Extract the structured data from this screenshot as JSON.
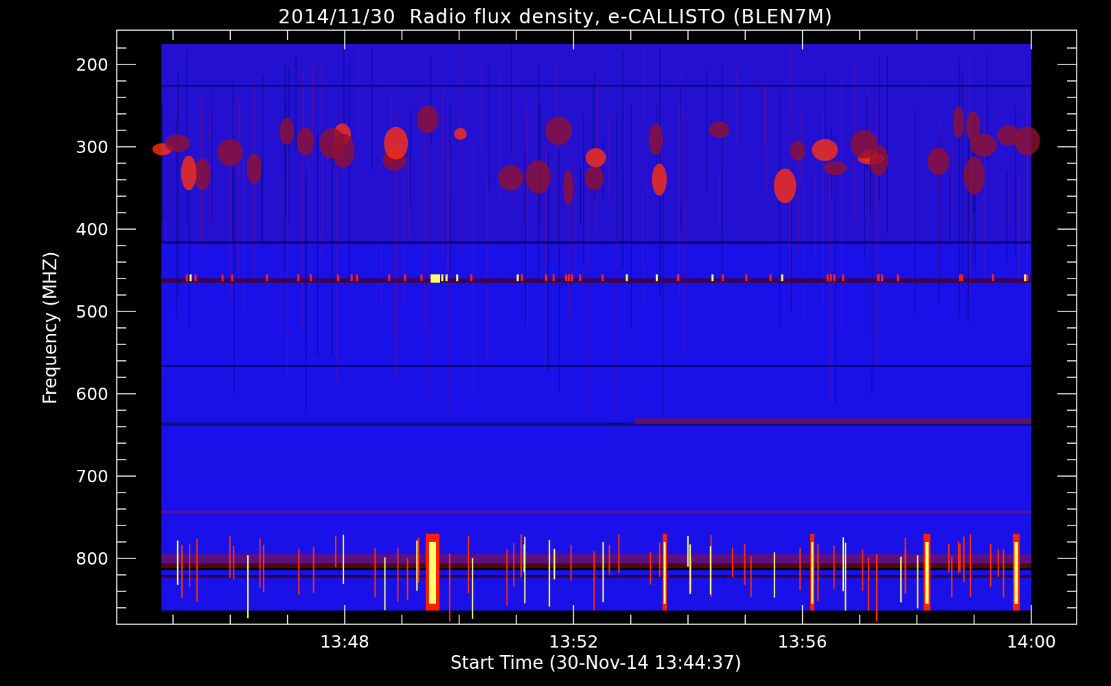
{
  "title": "2014/11/30  Radio flux density, e-CALLISTO (BLEN7M)",
  "y_axis": {
    "label": "Frequency (MHZ)",
    "ticks": [
      "200",
      "300",
      "400",
      "500",
      "600",
      "700",
      "800"
    ]
  },
  "x_axis": {
    "label": "Start Time (30-Nov-14 13:44:37)",
    "ticks": [
      "13:48",
      "13:52",
      "13:56",
      "14:00"
    ]
  }
}
